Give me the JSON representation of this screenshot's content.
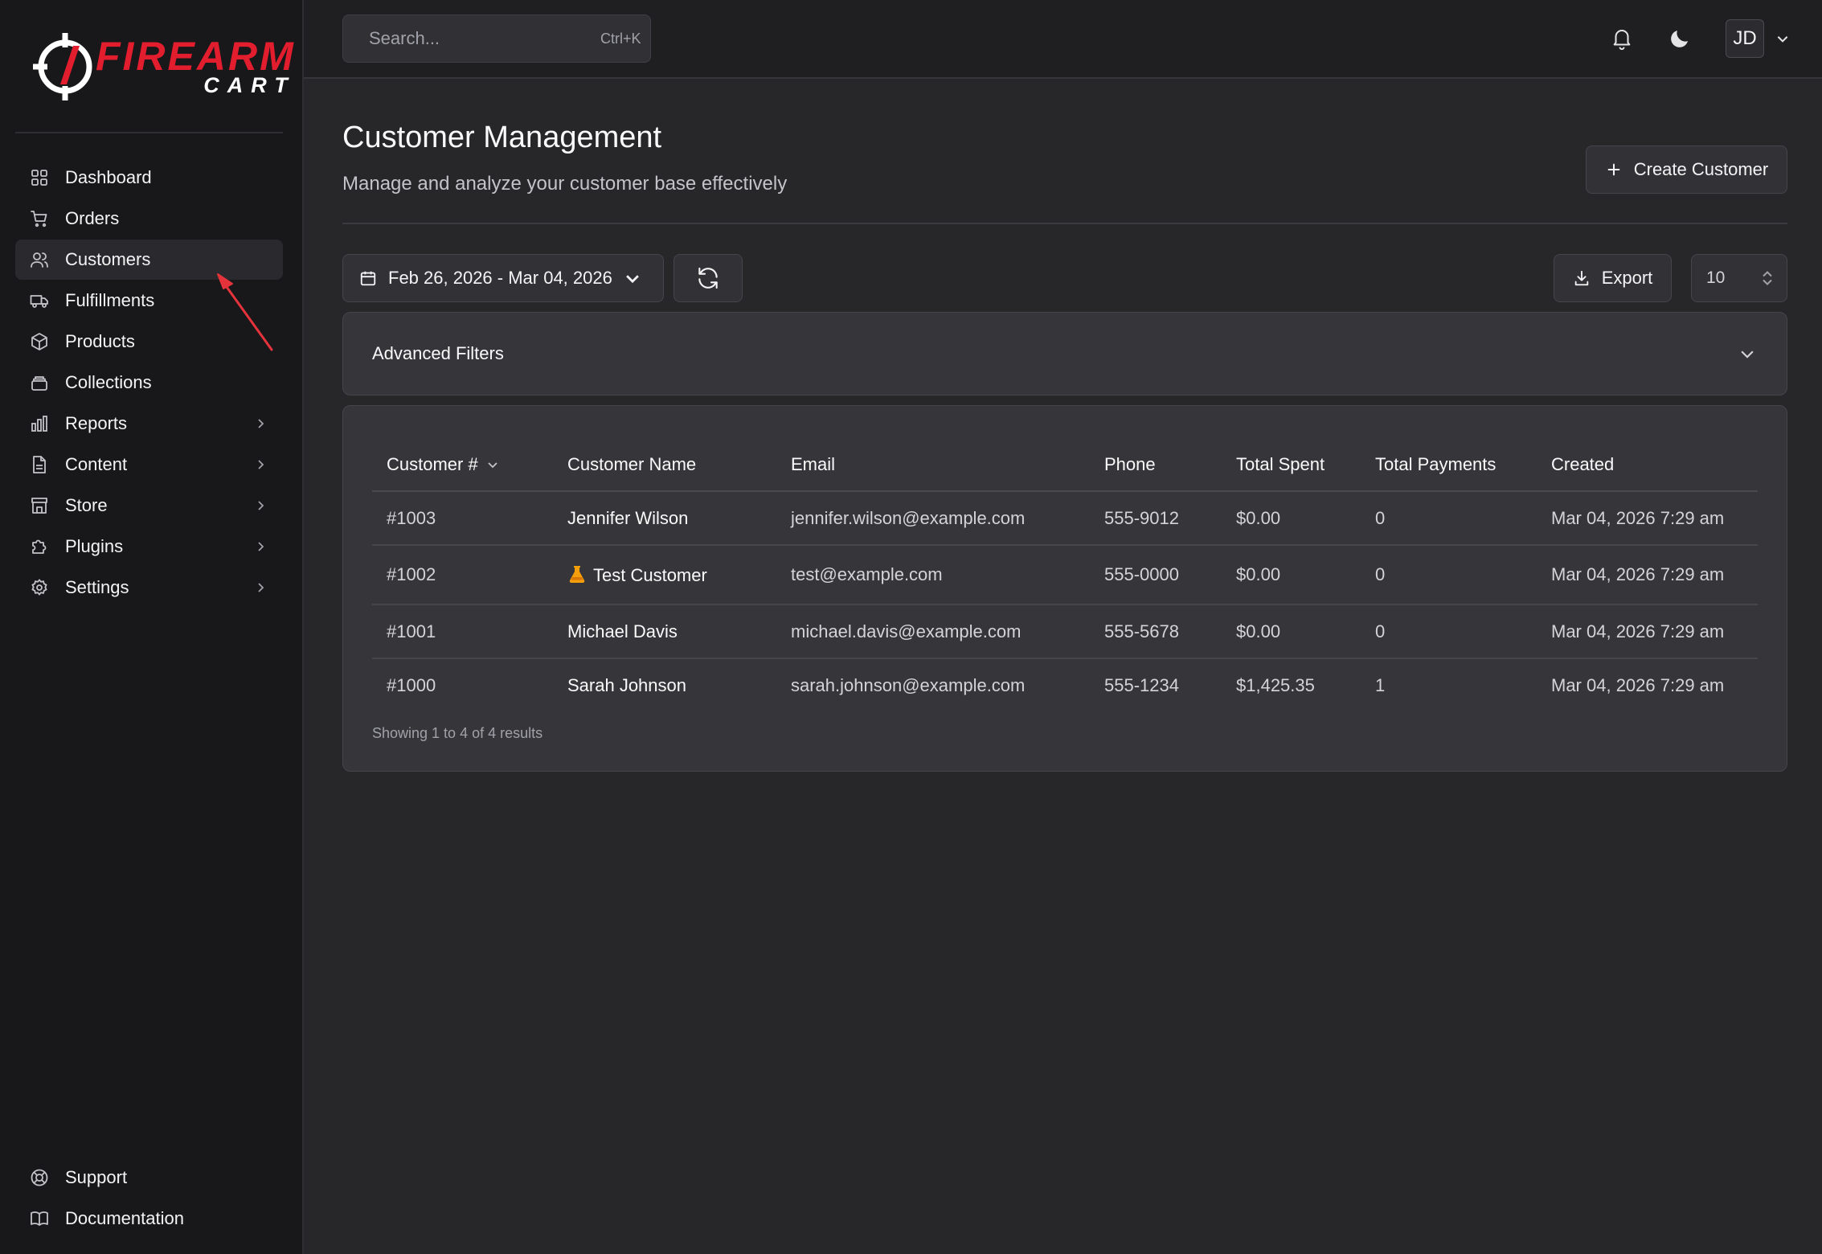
{
  "brand": {
    "main": "FIREARM",
    "sub": "CART"
  },
  "sidebar": {
    "items": [
      {
        "label": "Dashboard",
        "icon": "grid-icon",
        "has_children": false
      },
      {
        "label": "Orders",
        "icon": "cart-icon",
        "has_children": false
      },
      {
        "label": "Customers",
        "icon": "users-icon",
        "has_children": false,
        "active": true
      },
      {
        "label": "Fulfillments",
        "icon": "truck-icon",
        "has_children": false
      },
      {
        "label": "Products",
        "icon": "box-icon",
        "has_children": false
      },
      {
        "label": "Collections",
        "icon": "layers-icon",
        "has_children": false
      },
      {
        "label": "Reports",
        "icon": "bar-chart-icon",
        "has_children": true
      },
      {
        "label": "Content",
        "icon": "file-icon",
        "has_children": true
      },
      {
        "label": "Store",
        "icon": "store-icon",
        "has_children": true
      },
      {
        "label": "Plugins",
        "icon": "puzzle-icon",
        "has_children": true
      },
      {
        "label": "Settings",
        "icon": "gear-icon",
        "has_children": true
      }
    ],
    "bottom": [
      {
        "label": "Support",
        "icon": "lifebuoy-icon"
      },
      {
        "label": "Documentation",
        "icon": "book-icon"
      }
    ]
  },
  "topbar": {
    "search_placeholder": "Search...",
    "search_shortcut": "Ctrl+K",
    "avatar_initials": "JD"
  },
  "page": {
    "title": "Customer Management",
    "subtitle": "Manage and analyze your customer base effectively",
    "create_label": "Create Customer"
  },
  "toolbar": {
    "date_range": "Feb 26, 2026 - Mar 04, 2026",
    "export_label": "Export",
    "per_page": "10"
  },
  "filters": {
    "label": "Advanced Filters"
  },
  "table": {
    "columns": [
      "Customer #",
      "Customer Name",
      "Email",
      "Phone",
      "Total Spent",
      "Total Payments",
      "Created"
    ],
    "rows": [
      {
        "id": "#1003",
        "name": "Jennifer Wilson",
        "email": "jennifer.wilson@example.com",
        "phone": "555-9012",
        "spent": "$0.00",
        "payments": "0",
        "created": "Mar 04, 2026 7:29 am",
        "test": false
      },
      {
        "id": "#1002",
        "name": "Test Customer",
        "email": "test@example.com",
        "phone": "555-0000",
        "spent": "$0.00",
        "payments": "0",
        "created": "Mar 04, 2026 7:29 am",
        "test": true
      },
      {
        "id": "#1001",
        "name": "Michael Davis",
        "email": "michael.davis@example.com",
        "phone": "555-5678",
        "spent": "$0.00",
        "payments": "0",
        "created": "Mar 04, 2026 7:29 am",
        "test": false
      },
      {
        "id": "#1000",
        "name": "Sarah Johnson",
        "email": "sarah.johnson@example.com",
        "phone": "555-1234",
        "spent": "$1,425.35",
        "payments": "1",
        "created": "Mar 04, 2026 7:29 am",
        "test": false
      }
    ],
    "footer": "Showing 1 to 4 of 4 results"
  },
  "colors": {
    "brand_red": "#e11d2e",
    "active_bg": "#2a2a2e",
    "annotation_arrow": "#e5333b",
    "flask": "#f59e0b"
  }
}
